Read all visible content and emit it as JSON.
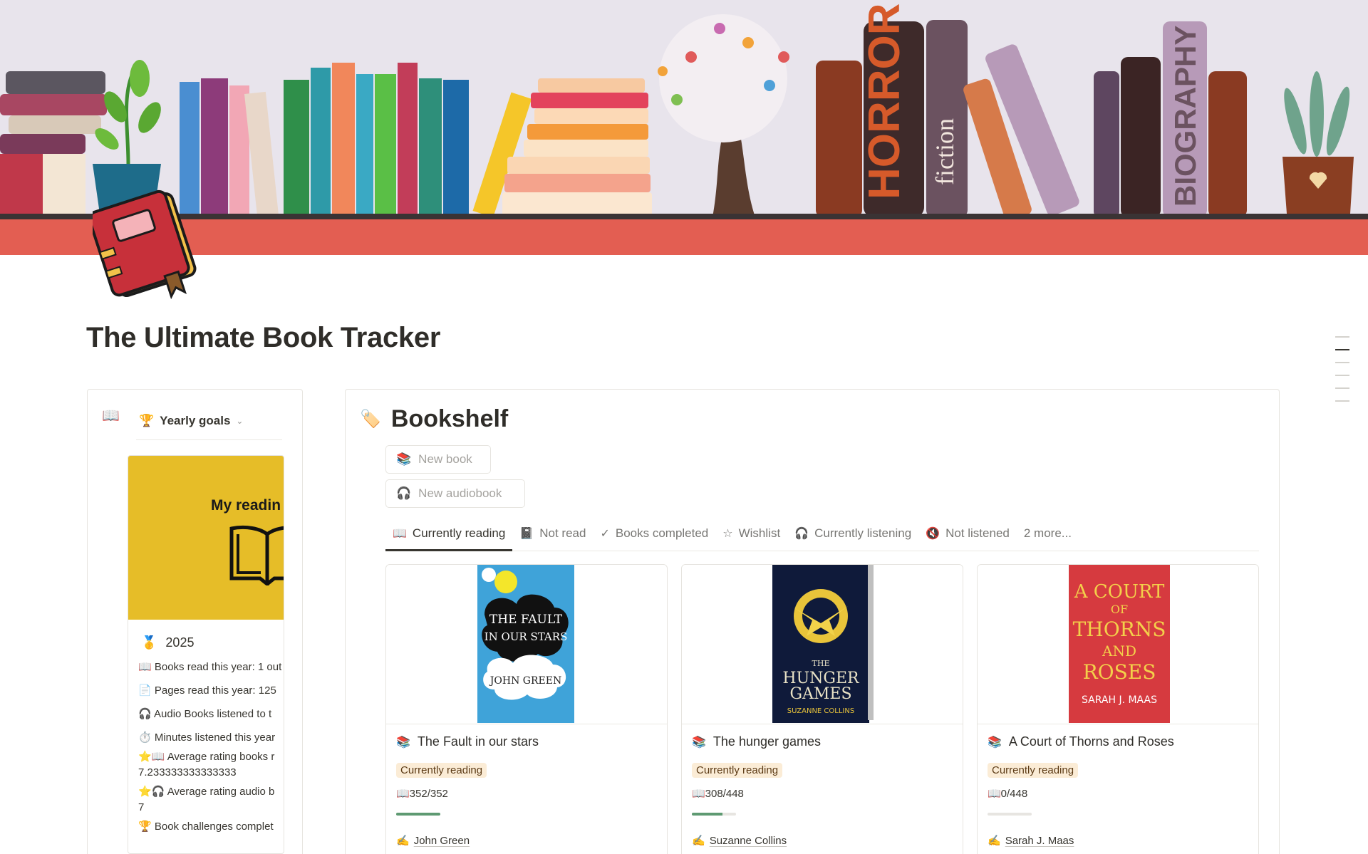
{
  "page": {
    "title": "The Ultimate Book Tracker",
    "banner_labels": {
      "horror": "HORROR",
      "fiction": "fiction",
      "biography": "BIOGRAPHY"
    }
  },
  "sidebar": {
    "book_icon": "📖",
    "tab_icon": "🏆",
    "tab_label": "Yearly goals",
    "card": {
      "cover_text": "My readin",
      "year_icon": "🥇",
      "year": "2025",
      "lines": [
        "📖 Books read this year: 1 out",
        "📄 Pages read this year: 125",
        "🎧 Audio Books listened to t",
        "⏱️ Minutes listened this year",
        "⭐📖 Average rating books r",
        "7.233333333333333",
        "⭐🎧 Average rating audio b",
        "7",
        "🏆 Book challenges complet"
      ]
    }
  },
  "bookshelf": {
    "icon": "🏷️",
    "title": "Bookshelf",
    "new_book_icon": "📚",
    "new_book": "New book",
    "new_audio_icon": "🎧",
    "new_audio": "New audiobook",
    "tabs": [
      {
        "icon": "📖",
        "label": "Currently reading"
      },
      {
        "icon": "📓",
        "label": "Not read"
      },
      {
        "icon": "✓",
        "label": "Books completed"
      },
      {
        "icon": "☆",
        "label": "Wishlist"
      },
      {
        "icon": "🎧",
        "label": "Currently listening"
      },
      {
        "icon": "🔇",
        "label": "Not listened"
      },
      {
        "icon": "",
        "label": "2 more..."
      }
    ],
    "cards": [
      {
        "icon": "📚",
        "title": "The Fault in our stars",
        "status": "Currently reading",
        "pages": "📖352/352",
        "progress": 1.0,
        "author_icon": "✍️",
        "author": "John Green",
        "cover": {
          "line1": "THE FAULT",
          "line2": "IN OUR STARS",
          "author": "JOHN GREEN",
          "bg": "#3fa3d9"
        }
      },
      {
        "icon": "📚",
        "title": "The hunger games",
        "status": "Currently reading",
        "pages": "📖308/448",
        "progress": 0.6875,
        "author_icon": "✍️",
        "author": "Suzanne Collins",
        "cover": {
          "line1": "THE",
          "line2": "HUNGER",
          "line3": "GAMES",
          "author": "SUZANNE COLLINS",
          "bg": "#0f1a3a"
        }
      },
      {
        "icon": "📚",
        "title": "A Court of Thorns and Roses",
        "status": "Currently reading",
        "pages": "📖0/448",
        "progress": 0.0,
        "author_icon": "✍️",
        "author": "Sarah J. Maas",
        "cover": {
          "line1": "A COURT",
          "line2": "OF",
          "line3": "THORNS",
          "line4": "AND",
          "line5": "ROSES",
          "author": "SARAH J. MAAS",
          "bg": "#d63a3f"
        }
      }
    ]
  },
  "colors": {
    "shelf": "#e35e52",
    "status_tag_bg": "#fbecd6",
    "progress": "#5e9a72",
    "goal_cover": "#e6bd28"
  }
}
